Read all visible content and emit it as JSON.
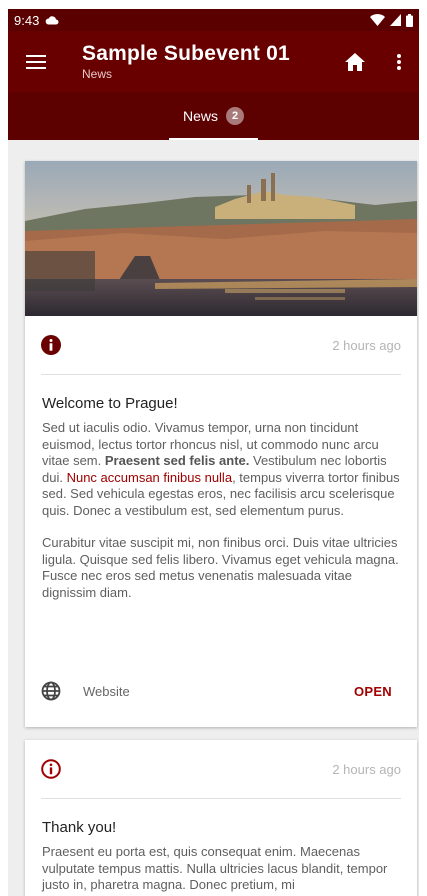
{
  "status_bar": {
    "time": "9:43"
  },
  "app_bar": {
    "title": "Sample Subevent 01",
    "subtitle": "News"
  },
  "tabs": [
    {
      "label": "News",
      "badge": "2"
    }
  ],
  "cards": [
    {
      "time": "2 hours ago",
      "title": "Welcome to Prague!",
      "body": {
        "p1_a": "Sed ut iaculis odio. Vivamus tempor, urna non tincidunt euismod, lectus tortor rhoncus nisl, ut commodo nunc arcu vitae sem. ",
        "p1_bold": "Praesent sed felis ante.",
        "p1_b": " Vestibulum nec lobortis dui. ",
        "p1_link": "Nunc accumsan finibus nulla",
        "p1_c": ", tempus viverra tortor finibus sed. Sed vehicula egestas eros, nec facilisis arcu scelerisque quis. Donec a vestibulum est, sed elementum purus.",
        "p2": "Curabitur vitae suscipit mi, non finibus orci. Duis vitae ultricies ligula. Quisque sed felis libero. Vivamus eget vehicula magna. Fusce nec eros sed metus venenatis malesuada vitae dignissim diam."
      },
      "action": {
        "label": "Website",
        "button": "OPEN"
      }
    },
    {
      "time": "2 hours ago",
      "title": "Thank you!",
      "body": "Praesent eu porta est, quis consequat enim. Maecenas vulputate tempus mattis. Nulla ultricies lacus blandit, tempor justo in, pharetra magna. Donec pretium, mi"
    }
  ],
  "colors": {
    "primary": "#680000",
    "primary_dark": "#5a0000",
    "accent": "#a00000"
  }
}
